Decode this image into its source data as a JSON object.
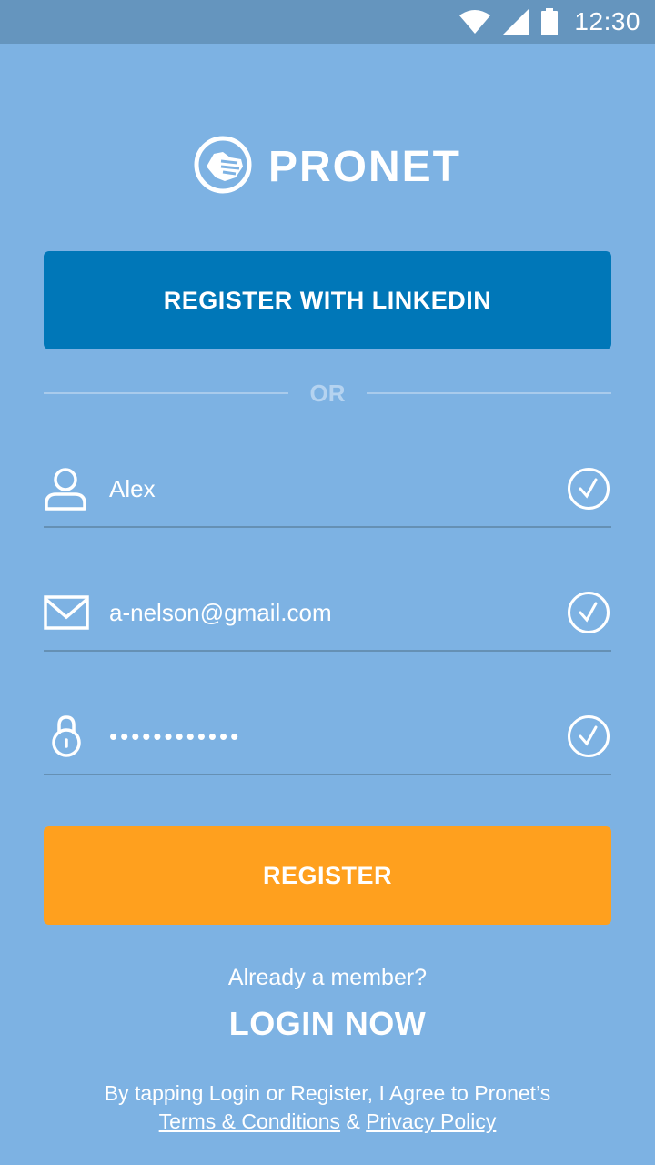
{
  "status_bar": {
    "time": "12:30",
    "icons": [
      "wifi-icon",
      "cell-signal-icon",
      "battery-icon"
    ]
  },
  "logo": {
    "icon": "handshake-icon",
    "text": "PRONET"
  },
  "linkedin_button": {
    "label": "REGISTER WITH LINKEDIN"
  },
  "divider": {
    "label": "OR"
  },
  "form": {
    "name": {
      "icon": "user-icon",
      "value": "Alex",
      "valid": true
    },
    "email": {
      "icon": "mail-icon",
      "value": "a-nelson@gmail.com",
      "valid": true
    },
    "password": {
      "icon": "lock-icon",
      "value": "••••••••••••",
      "valid": true
    }
  },
  "register_button": {
    "label": "REGISTER"
  },
  "login_prompt": {
    "question": "Already a member?",
    "link": "LOGIN NOW"
  },
  "legal": {
    "line1": "By tapping Login or Register, I Agree to Pronet’s",
    "terms": "Terms & Conditions",
    "ampersand": "&",
    "privacy": "Privacy Policy"
  },
  "colors": {
    "background": "#7db2e3",
    "status_bar": "#6595be",
    "linkedin": "#0077b8",
    "register": "#ffa01e"
  }
}
